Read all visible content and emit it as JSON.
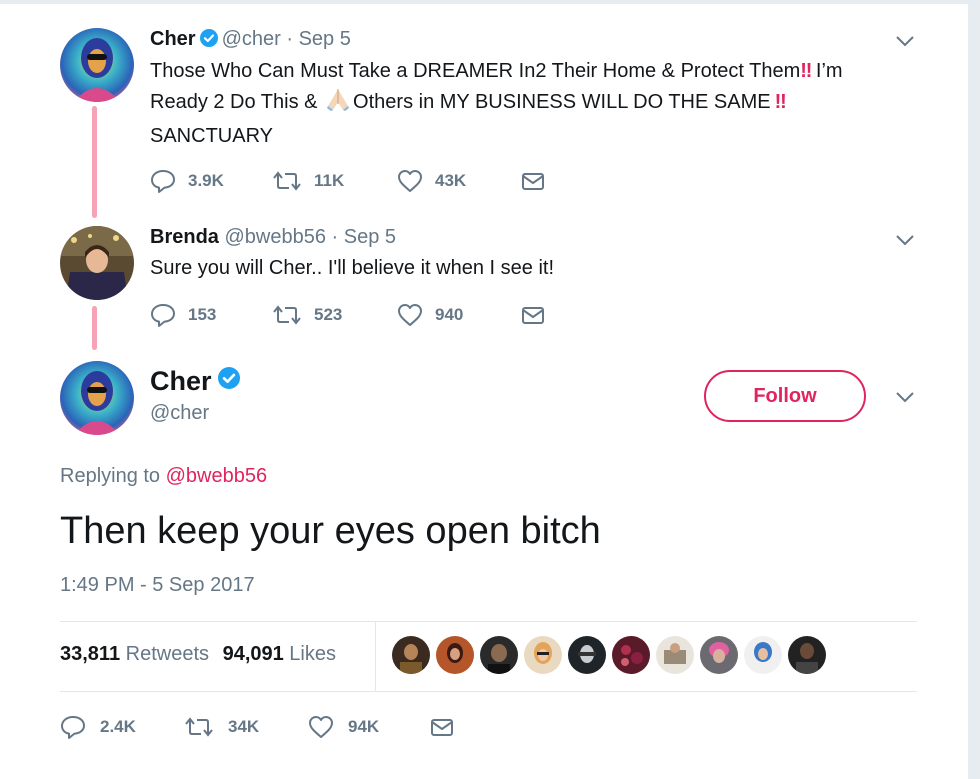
{
  "thread": [
    {
      "name": "Cher",
      "handle": "@cher",
      "dot": "·",
      "date": "Sep 5",
      "text_line1": "Those Who Can Must Take a DREAMER In2 Their Home & Protect Them",
      "bang": "‼",
      "text_line1_end": " I’m",
      "text_line2": "Ready 2 Do This & ",
      "text_line2_b": "Others in MY BUSINESS WILL DO THE SAME",
      "text_line3": "SANCTUARY",
      "replies": "3.9K",
      "retweets": "11K",
      "likes": "43K"
    },
    {
      "name": "Brenda",
      "handle": "@bwebb56",
      "dot": "·",
      "date": "Sep 5",
      "text": "Sure you will Cher.. I'll believe it when I see it!",
      "replies": "153",
      "retweets": "523",
      "likes": "940"
    }
  ],
  "main": {
    "name": "Cher",
    "handle": "@cher",
    "follow_label": "Follow",
    "replying_prefix": "Replying to ",
    "replying_to": "@bwebb56",
    "text": "Then keep your eyes open bitch",
    "timestamp": "1:49 PM - 5 Sep 2017",
    "retweet_count": "33,811",
    "retweet_label": " Retweets",
    "like_count": "94,091",
    "like_label": " Likes",
    "replies": "2.4K",
    "retweets": "34K",
    "likes": "94K"
  },
  "colors": {
    "accent": "#e0245e",
    "verified": "#1da1f2",
    "muted": "#657786",
    "thread_line": "#f5a3b5"
  }
}
